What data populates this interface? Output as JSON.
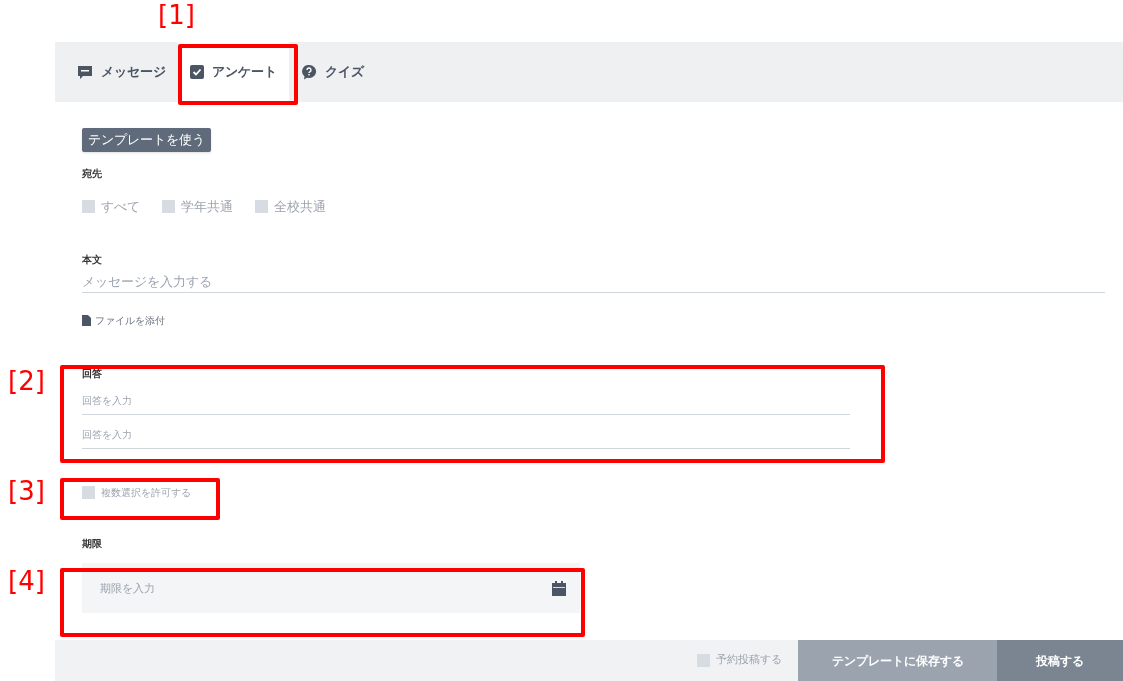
{
  "tabs": [
    {
      "label": "メッセージ",
      "selected": false
    },
    {
      "label": "アンケート",
      "selected": true
    },
    {
      "label": "クイズ",
      "selected": false
    }
  ],
  "template_button": "テンプレートを使う",
  "recipients": {
    "label": "宛先",
    "options": [
      {
        "label": "すべて",
        "checked": false
      },
      {
        "label": "学年共通",
        "checked": false
      },
      {
        "label": "全校共通",
        "checked": false
      }
    ]
  },
  "body": {
    "label": "本文",
    "placeholder": "メッセージを入力する"
  },
  "attach_link": "ファイルを添付",
  "answers": {
    "label": "回答",
    "fields": [
      {
        "placeholder": "回答を入力"
      },
      {
        "placeholder": "回答を入力"
      }
    ]
  },
  "multiple_choice": {
    "label": "複数選択を許可する",
    "checked": false
  },
  "deadline": {
    "label": "期限",
    "placeholder": "期限を入力"
  },
  "footer": {
    "schedule": {
      "label": "予約投稿する",
      "checked": false
    },
    "save_button": "テンプレートに保存する",
    "post_button": "投稿する"
  },
  "callouts": [
    {
      "label": "[1]"
    },
    {
      "label": "[2]"
    },
    {
      "label": "[3]"
    },
    {
      "label": "[4]"
    }
  ]
}
